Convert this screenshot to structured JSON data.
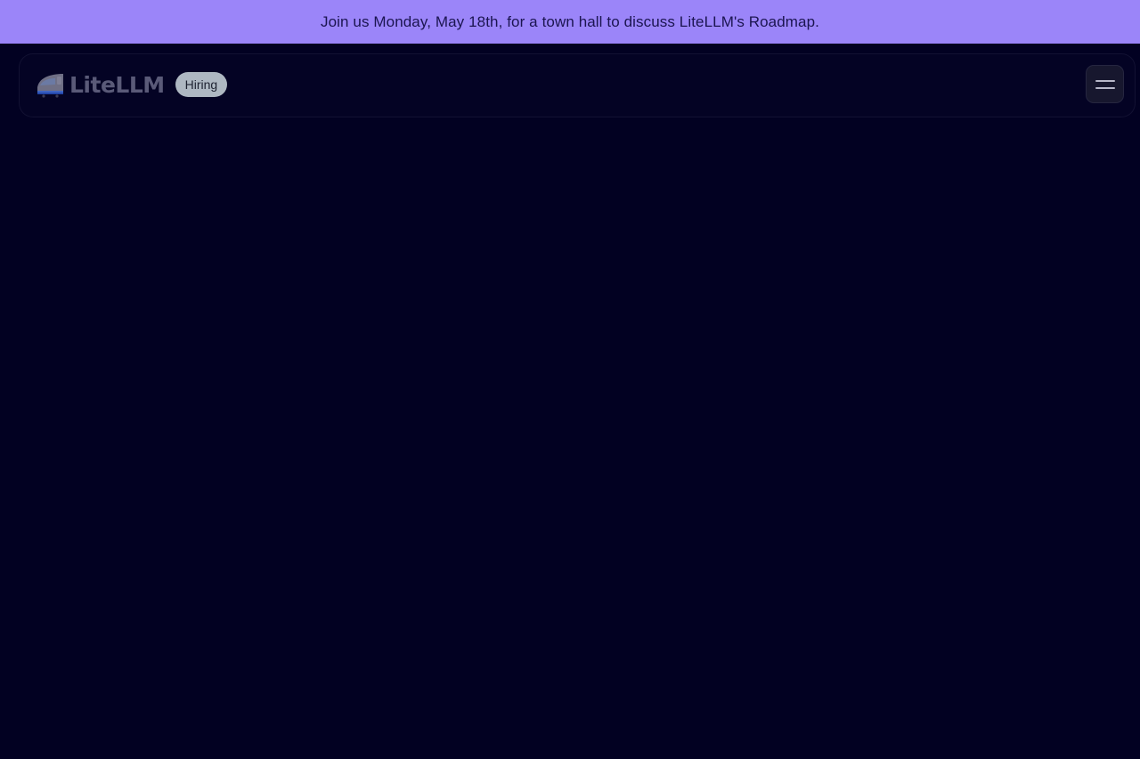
{
  "banner": {
    "text": "Join us Monday, May 18th, for a town hall to discuss LiteLLM's Roadmap.",
    "background": "#9b85f9",
    "text_color": "#1b1550"
  },
  "page": {
    "background": "#020122"
  },
  "navbar": {
    "logo_text": "LiteLLM",
    "logo_icon": "bullet-train-icon",
    "badge_label": "Hiring",
    "menu_icon": "hamburger-menu-icon"
  }
}
